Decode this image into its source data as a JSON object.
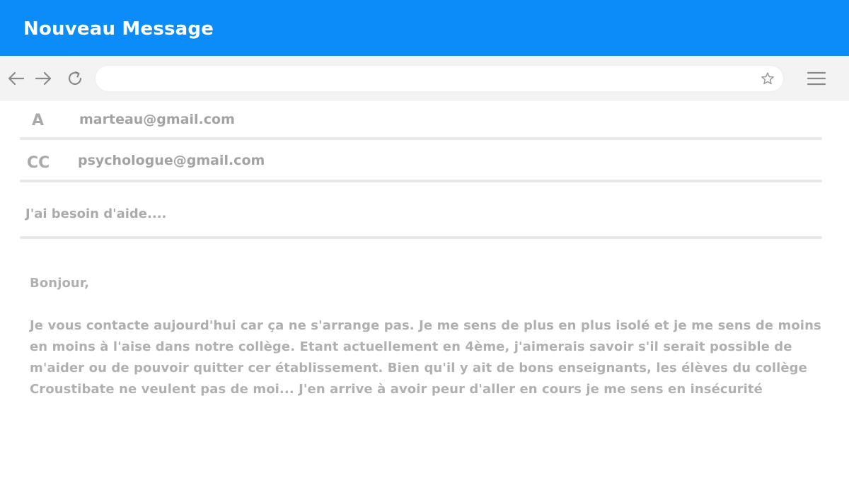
{
  "window": {
    "title": "Nouveau Message"
  },
  "toolbar": {
    "back_icon": "arrow-left-icon",
    "forward_icon": "arrow-right-icon",
    "reload_icon": "reload-icon",
    "address_value": "",
    "star_icon": "star-icon",
    "menu_icon": "hamburger-menu-icon"
  },
  "fields": {
    "to": {
      "label": "A",
      "value": "marteau@gmail.com"
    },
    "cc": {
      "label": "CC",
      "value": "psychologue@gmail.com"
    },
    "subject": "J'ai besoin d'aide...."
  },
  "message": {
    "greeting": "Bonjour,",
    "lines": [
      "Je vous contacte aujourd'hui car ça ne s'arrange pas. Je me sens de plus en plus isolé et je me sens de moins",
      "en moins à l'aise dans notre collège. Etant actuellement en 4ème, j'aimerais savoir s'il serait possible de",
      "m'aider ou de pouvoir quitter cer établissement. Bien qu'il y ait de bons enseignants, les élèves du collège",
      "Croustibate ne veulent pas de moi... J'en arrive à avoir peur d'aller en cours je me sens en insécurité"
    ]
  },
  "colors": {
    "titlebar": "#0c8cf9",
    "toolbar": "#f3f3f3",
    "text_gray": "#a9a9a9"
  }
}
